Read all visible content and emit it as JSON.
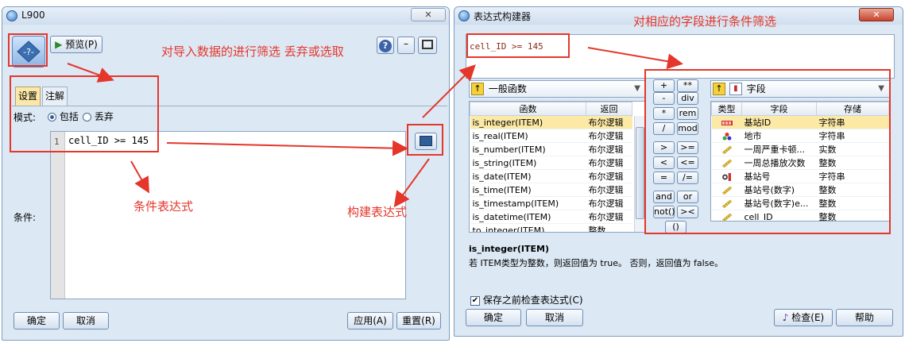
{
  "left_window": {
    "title": "L900",
    "preview_label": "预览(P)",
    "tabs": [
      "设置",
      "注解"
    ],
    "mode_label": "模式:",
    "mode_include": "包括",
    "mode_discard": "丢弃",
    "condition_label": "条件:",
    "line_number": "1",
    "expression": "cell_ID >= 145",
    "ok_label": "确定",
    "cancel_label": "取消",
    "apply_label": "应用(A)",
    "reset_label": "重置(R)"
  },
  "right_window": {
    "title": "表达式构建器",
    "expression": "cell_ID >= 145",
    "function_category": "一般函数",
    "func_headers": [
      "函数",
      "返回"
    ],
    "functions": [
      {
        "name": "is_integer(ITEM)",
        "ret": "布尔逻辑"
      },
      {
        "name": "is_real(ITEM)",
        "ret": "布尔逻辑"
      },
      {
        "name": "is_number(ITEM)",
        "ret": "布尔逻辑"
      },
      {
        "name": "is_string(ITEM)",
        "ret": "布尔逻辑"
      },
      {
        "name": "is_date(ITEM)",
        "ret": "布尔逻辑"
      },
      {
        "name": "is_time(ITEM)",
        "ret": "布尔逻辑"
      },
      {
        "name": "is_timestamp(ITEM)",
        "ret": "布尔逻辑"
      },
      {
        "name": "is_datetime(ITEM)",
        "ret": "布尔逻辑"
      },
      {
        "name": "to_integer(ITEM)",
        "ret": "整数"
      }
    ],
    "operators": [
      "+",
      "**",
      "-",
      "div",
      "*",
      "rem",
      "/",
      "mod",
      ">",
      ">=",
      "<",
      "<=",
      "=",
      "/=",
      "and",
      "or",
      "not()",
      "><",
      "()"
    ],
    "field_combo": "字段",
    "field_headers": [
      "类型",
      "字段",
      "存储"
    ],
    "fields": [
      {
        "name": "基站ID",
        "storage": "字符串",
        "icon": "nominal-icon"
      },
      {
        "name": "地市",
        "storage": "字符串",
        "icon": "set-icon"
      },
      {
        "name": "一周严重卡顿...",
        "storage": "实数",
        "icon": "continuous-icon"
      },
      {
        "name": "一周总播放次数",
        "storage": "整数",
        "icon": "continuous-icon"
      },
      {
        "name": "基站号",
        "storage": "字符串",
        "icon": "flag-icon"
      },
      {
        "name": "基站号(数字)",
        "storage": "整数",
        "icon": "continuous-icon"
      },
      {
        "name": "基站号(数字)e...",
        "storage": "整数",
        "icon": "continuous-icon"
      },
      {
        "name": "cell_ID",
        "storage": "整数",
        "icon": "continuous-icon"
      }
    ],
    "desc_title": "is_integer(ITEM)",
    "desc_text": "若 ITEM类型为整数，则返回值为 true。 否则，返回值为 false。",
    "check_label": "保存之前检查表达式(C)",
    "ok_label": "确定",
    "cancel_label": "取消",
    "check_button": "检查(E)",
    "help_button": "帮助"
  },
  "annotations": {
    "filter_note": "对导入数据的进行筛选 丢弃或选取",
    "condition_note": "条件表达式",
    "builder_note": "构建表达式",
    "field_note": "对相应的字段进行条件筛选"
  },
  "colors": {
    "annotation": "#e5362b",
    "selection": "#fce9a6"
  }
}
